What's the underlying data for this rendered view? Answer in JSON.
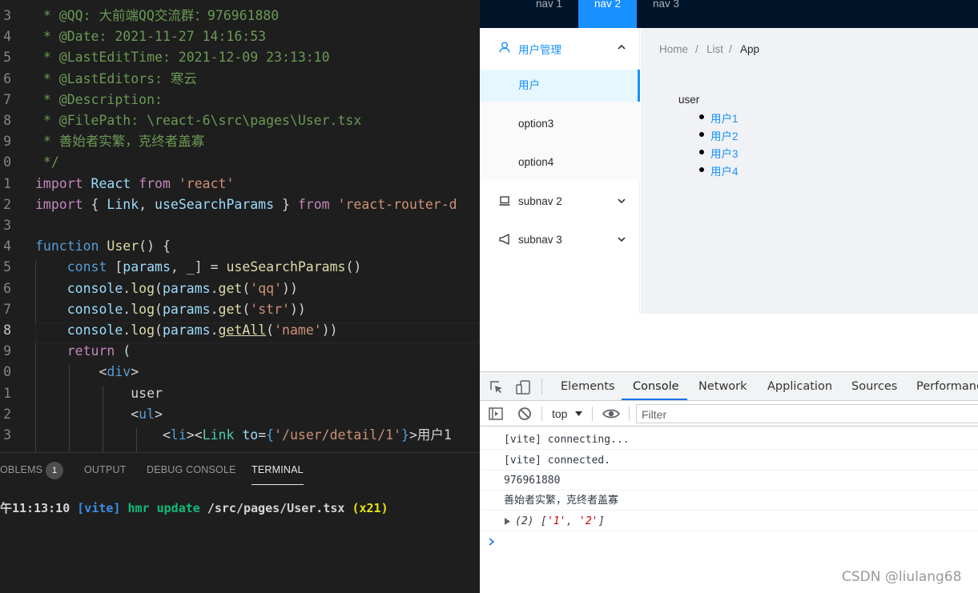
{
  "editor": {
    "lines": [
      {
        "num": "3",
        "segs": [
          {
            "t": " * @QQ: 大前端QQ交流群：976961880",
            "c": "c-comment"
          }
        ]
      },
      {
        "num": "4",
        "segs": [
          {
            "t": " * @Date: 2021-11-27 14:16:53",
            "c": "c-comment"
          }
        ]
      },
      {
        "num": "5",
        "segs": [
          {
            "t": " * @LastEditTime: 2021-12-09 23:13:10",
            "c": "c-comment"
          }
        ]
      },
      {
        "num": "6",
        "segs": [
          {
            "t": " * @LastEditors: 寒云",
            "c": "c-comment"
          }
        ]
      },
      {
        "num": "7",
        "segs": [
          {
            "t": " * @Description:",
            "c": "c-comment"
          }
        ]
      },
      {
        "num": "8",
        "segs": [
          {
            "t": " * @FilePath: \\react-6\\src\\pages\\User.tsx",
            "c": "c-comment"
          }
        ]
      },
      {
        "num": "9",
        "segs": [
          {
            "t": " * 善始者实繁，克终者盖寡",
            "c": "c-comment"
          }
        ]
      },
      {
        "num": "0",
        "segs": [
          {
            "t": " */",
            "c": "c-comment"
          }
        ]
      },
      {
        "num": "1",
        "segs": [
          {
            "t": "import",
            "c": "c-kw"
          },
          {
            "t": " React ",
            "c": "c-var"
          },
          {
            "t": "from",
            "c": "c-kw"
          },
          {
            "t": " 'react'",
            "c": "c-str"
          }
        ]
      },
      {
        "num": "2",
        "segs": [
          {
            "t": "import",
            "c": "c-kw"
          },
          {
            "t": " { ",
            "c": "c-plain"
          },
          {
            "t": "Link",
            "c": "c-var"
          },
          {
            "t": ", ",
            "c": "c-plain"
          },
          {
            "t": "useSearchParams",
            "c": "c-var"
          },
          {
            "t": " } ",
            "c": "c-plain"
          },
          {
            "t": "from",
            "c": "c-kw"
          },
          {
            "t": " 'react-router-d",
            "c": "c-str"
          }
        ]
      },
      {
        "num": "3",
        "segs": []
      },
      {
        "num": "4",
        "segs": [
          {
            "t": "function",
            "c": "c-blue"
          },
          {
            "t": " ",
            "c": "c-plain"
          },
          {
            "t": "User",
            "c": "c-fn"
          },
          {
            "t": "() {",
            "c": "c-plain"
          }
        ]
      },
      {
        "num": "5",
        "segs": [
          {
            "t": "    ",
            "c": "c-plain"
          },
          {
            "t": "const",
            "c": "c-blue"
          },
          {
            "t": " [",
            "c": "c-plain"
          },
          {
            "t": "params",
            "c": "c-var"
          },
          {
            "t": ", ",
            "c": "c-plain"
          },
          {
            "t": "_",
            "c": "c-var"
          },
          {
            "t": "] = ",
            "c": "c-plain"
          },
          {
            "t": "useSearchParams",
            "c": "c-fn"
          },
          {
            "t": "()",
            "c": "c-plain"
          }
        ]
      },
      {
        "num": "6",
        "segs": [
          {
            "t": "    ",
            "c": "c-plain"
          },
          {
            "t": "console",
            "c": "c-var"
          },
          {
            "t": ".",
            "c": "c-plain"
          },
          {
            "t": "log",
            "c": "c-fn"
          },
          {
            "t": "(",
            "c": "c-plain"
          },
          {
            "t": "params",
            "c": "c-var"
          },
          {
            "t": ".",
            "c": "c-plain"
          },
          {
            "t": "get",
            "c": "c-fn"
          },
          {
            "t": "(",
            "c": "c-plain"
          },
          {
            "t": "'qq'",
            "c": "c-str"
          },
          {
            "t": "))",
            "c": "c-plain"
          }
        ]
      },
      {
        "num": "7",
        "segs": [
          {
            "t": "    ",
            "c": "c-plain"
          },
          {
            "t": "console",
            "c": "c-var"
          },
          {
            "t": ".",
            "c": "c-plain"
          },
          {
            "t": "log",
            "c": "c-fn"
          },
          {
            "t": "(",
            "c": "c-plain"
          },
          {
            "t": "params",
            "c": "c-var"
          },
          {
            "t": ".",
            "c": "c-plain"
          },
          {
            "t": "get",
            "c": "c-fn"
          },
          {
            "t": "(",
            "c": "c-plain"
          },
          {
            "t": "'str'",
            "c": "c-str"
          },
          {
            "t": "))",
            "c": "c-plain"
          }
        ]
      },
      {
        "num": "8",
        "active": true,
        "segs": [
          {
            "t": "    ",
            "c": "c-plain"
          },
          {
            "t": "console",
            "c": "c-var"
          },
          {
            "t": ".",
            "c": "c-plain"
          },
          {
            "t": "log",
            "c": "c-fn"
          },
          {
            "t": "(",
            "c": "c-plain"
          },
          {
            "t": "params",
            "c": "c-var"
          },
          {
            "t": ".",
            "c": "c-plain"
          },
          {
            "t": "getAll",
            "c": "c-link"
          },
          {
            "t": "(",
            "c": "c-plain"
          },
          {
            "t": "'name'",
            "c": "c-str"
          },
          {
            "t": "))",
            "c": "c-plain"
          }
        ]
      },
      {
        "num": "9",
        "segs": [
          {
            "t": "    ",
            "c": "c-plain"
          },
          {
            "t": "return",
            "c": "c-kw"
          },
          {
            "t": " (",
            "c": "c-plain"
          }
        ]
      },
      {
        "num": "0",
        "segs": [
          {
            "t": "        ",
            "c": "c-plain"
          },
          {
            "t": "<",
            "c": "c-plain"
          },
          {
            "t": "div",
            "c": "c-tag"
          },
          {
            "t": ">",
            "c": "c-plain"
          }
        ]
      },
      {
        "num": "1",
        "segs": [
          {
            "t": "            user",
            "c": "c-plain"
          }
        ]
      },
      {
        "num": "2",
        "segs": [
          {
            "t": "            ",
            "c": "c-plain"
          },
          {
            "t": "<",
            "c": "c-plain"
          },
          {
            "t": "ul",
            "c": "c-tag"
          },
          {
            "t": ">",
            "c": "c-plain"
          }
        ]
      },
      {
        "num": "3",
        "segs": [
          {
            "t": "                ",
            "c": "c-plain"
          },
          {
            "t": "<",
            "c": "c-plain"
          },
          {
            "t": "li",
            "c": "c-tag"
          },
          {
            "t": "><",
            "c": "c-plain"
          },
          {
            "t": "Link",
            "c": "c-type"
          },
          {
            "t": " ",
            "c": "c-plain"
          },
          {
            "t": "to",
            "c": "c-attr"
          },
          {
            "t": "=",
            "c": "c-plain"
          },
          {
            "t": "{",
            "c": "c-blue"
          },
          {
            "t": "'/user/detail/1'",
            "c": "c-str"
          },
          {
            "t": "}",
            "c": "c-blue"
          },
          {
            "t": ">用户1",
            "c": "c-plain"
          }
        ]
      }
    ]
  },
  "panel": {
    "tabs": [
      {
        "label": "OBLEMS",
        "active": false
      },
      {
        "label": "OUTPUT",
        "active": false
      },
      {
        "label": "DEBUG CONSOLE",
        "active": false
      },
      {
        "label": "TERMINAL",
        "active": true
      }
    ],
    "problems_count": "1",
    "terminal": {
      "time": "午11:13:10",
      "tag": "[vite]",
      "msg": "hmr update",
      "path": "/src/pages/User.tsx",
      "count": "(x21)"
    }
  },
  "browser": {
    "topnav": [
      {
        "label": "nav 1",
        "selected": false
      },
      {
        "label": "nav 2",
        "selected": true
      },
      {
        "label": "nav 3",
        "selected": false
      }
    ],
    "sider": {
      "user_mgmt": "用户管理",
      "items": [
        {
          "label": "用户",
          "selected": true
        },
        {
          "label": "option3",
          "selected": false
        },
        {
          "label": "option4",
          "selected": false
        }
      ],
      "subnav2": "subnav 2",
      "subnav3": "subnav 3"
    },
    "breadcrumb": [
      "Home",
      "List",
      "App"
    ],
    "breadcrumb_sep": "/",
    "content": {
      "user": "user",
      "links": [
        "用户1",
        "用户2",
        "用户3",
        "用户4"
      ]
    }
  },
  "devtools": {
    "tabs": [
      "Elements",
      "Console",
      "Network",
      "Application",
      "Sources",
      "Performanc"
    ],
    "active_tab": "Console",
    "context": "top",
    "filter_placeholder": "Filter",
    "console_lines": [
      "[vite] connecting...",
      "[vite] connected.",
      "976961880",
      "善始者实繁，克终者盖寡"
    ],
    "array_prefix": "(2) ",
    "array_items": [
      "'1'",
      "'2'"
    ],
    "prompt": ">"
  },
  "watermark": "CSDN @liulang68",
  "colors": {
    "primary": "#1890ff",
    "nav_bg": "#001529",
    "editor_bg": "#1e1e1e",
    "selected_bg": "#e6f7ff"
  }
}
